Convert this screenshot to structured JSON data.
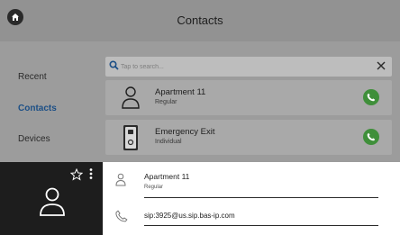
{
  "header": {
    "title": "Contacts",
    "home_icon": "home-icon"
  },
  "nav": {
    "items": [
      {
        "label": "Recent",
        "active": false
      },
      {
        "label": "Contacts",
        "active": true
      },
      {
        "label": "Devices",
        "active": false
      }
    ]
  },
  "search": {
    "placeholder": "Tap to search...",
    "value": ""
  },
  "contacts": [
    {
      "name": "Apartment 11",
      "type": "Regular",
      "icon": "person-icon"
    },
    {
      "name": "Emergency Exit",
      "type": "Individual",
      "icon": "intercom-panel-icon"
    }
  ],
  "detail": {
    "name": "Apartment 11",
    "type": "Regular",
    "sip": "sip:3925@us.sip.bas-ip.com"
  },
  "colors": {
    "accent": "#1c4f86",
    "call_green": "#3f8f3a",
    "detail_panel": "#1d1d1d"
  }
}
